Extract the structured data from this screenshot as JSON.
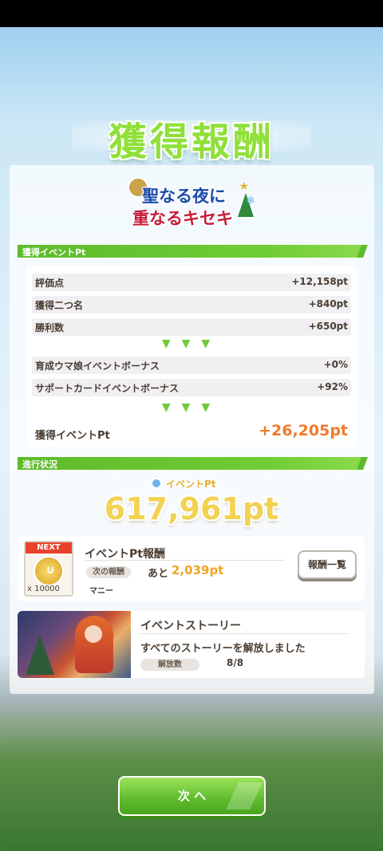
{
  "header": {
    "title": "獲得報酬"
  },
  "event": {
    "logo_line1": "聖なる夜に",
    "logo_line2": "重なるキセキ"
  },
  "section_points": {
    "label": "獲得イベントPt",
    "base_rows": [
      {
        "label": "評価点",
        "value": "+12,158pt"
      },
      {
        "label": "獲得二つ名",
        "value": "+840pt"
      },
      {
        "label": "勝利数",
        "value": "+650pt"
      }
    ],
    "bonus_rows": [
      {
        "label": "育成ウマ娘イベントボーナス",
        "value": "+0%"
      },
      {
        "label": "サポートカードイベントボーナス",
        "value": "+92%"
      }
    ],
    "arrows": "▼▼▼",
    "total_label": "獲得イベントPt",
    "total_value": "+26,205pt"
  },
  "section_progress": {
    "label": "進行状況",
    "pt_label": "イベントPt",
    "pt_total": "617,961pt"
  },
  "reward": {
    "next_tag": "NEXT",
    "quantity": "x 10000",
    "title": "イベントPt報酬",
    "next_reward_label": "次の報酬",
    "remaining_prefix": "あと",
    "remaining_value": "2,039pt",
    "reward_name": "マニー",
    "list_button": "報酬一覧"
  },
  "story": {
    "title": "イベントストーリー",
    "message": "すべてのストーリーを解放しました",
    "count_label": "解放数",
    "count_value": "8/8"
  },
  "footer": {
    "next_button": "次 へ"
  },
  "colors": {
    "accent_green": "#6fcc35",
    "points_orange": "#f07b2d",
    "gold": "#f0a426"
  }
}
